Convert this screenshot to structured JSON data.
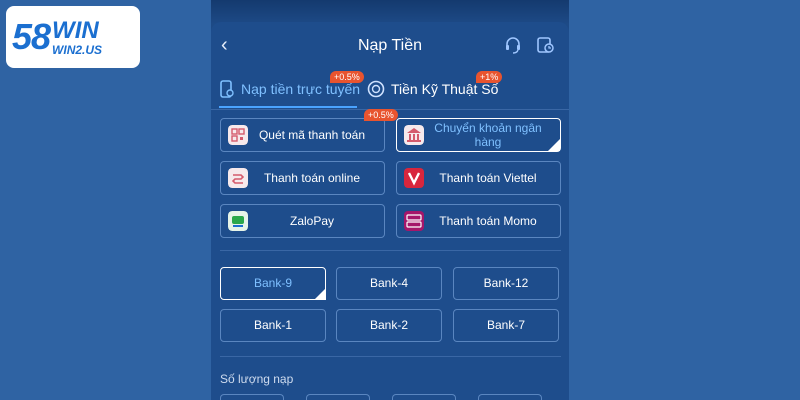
{
  "brand": {
    "logo_num": "58",
    "logo_win": "WIN",
    "logo_sub": "WIN2.US"
  },
  "header": {
    "title": "Nạp Tiền",
    "back_glyph": "‹"
  },
  "tabs": [
    {
      "label": "Nạp tiền trực tuyến",
      "badge": "+0.5%",
      "active": true
    },
    {
      "label": "Tiền Kỹ Thuật Số",
      "badge": "+1%",
      "active": false
    }
  ],
  "methods": [
    {
      "label": "Quét mã thanh toán",
      "icon": "qr-icon",
      "badge": ""
    },
    {
      "label": "Chuyển khoản ngân hàng",
      "icon": "bank-icon",
      "badge": "+0.5%",
      "selected": true
    },
    {
      "label": "Thanh toán online",
      "icon": "online-pay-icon",
      "badge": ""
    },
    {
      "label": "Thanh toán Viettel",
      "icon": "viettel-icon",
      "badge": ""
    },
    {
      "label": "ZaloPay",
      "icon": "zalopay-icon",
      "badge": ""
    },
    {
      "label": "Thanh toán Momo",
      "icon": "momo-icon",
      "badge": ""
    }
  ],
  "banks": [
    {
      "label": "Bank-9",
      "selected": true
    },
    {
      "label": "Bank-4"
    },
    {
      "label": "Bank-12"
    },
    {
      "label": "Bank-1"
    },
    {
      "label": "Bank-2"
    },
    {
      "label": "Bank-7"
    }
  ],
  "amount": {
    "label": "Số lượng nạp"
  },
  "colors": {
    "page_bg": "#2f63a3",
    "panel_bg": "#1e4d8c",
    "accent": "#7fc0ff",
    "badge": "#e8542f"
  }
}
